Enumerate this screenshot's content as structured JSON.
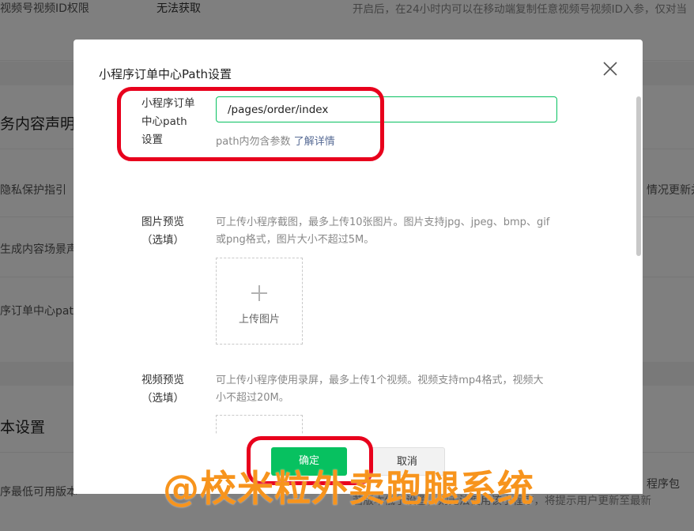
{
  "background": {
    "rows": [
      {
        "left": "视频号视频ID权限",
        "mid": "无法获取",
        "right": "开启后，在24小时内可以在移动端复制任意视频号视频ID入参，仅对当"
      },
      {
        "left": "务内容声明"
      },
      {
        "left": "隐私保护指引",
        "right": "情况更新并"
      },
      {
        "left": "生成内容场景声"
      },
      {
        "left": "序订单中心path"
      },
      {
        "left": "本设置"
      },
      {
        "left": "序最低可用版本",
        "right": "程序包"
      },
      {
        "right_partial": "若版本低于设置，则无法使用该小程序，将提示用户更新至最新"
      }
    ]
  },
  "dialog": {
    "title": "小程序订单中心Path设置",
    "path_field": {
      "label_lines": [
        "小程序订单",
        "中心path",
        "设置"
      ],
      "value": "/pages/order/index",
      "hint": "path内勿含参数",
      "hint_link": "了解详情"
    },
    "image_preview": {
      "label_lines": [
        "图片预览",
        "（选填）"
      ],
      "desc_lines": [
        "可上传小程序截图，最多上传10张图片。图片支持jpg、jpeg、bmp、gif",
        "或png格式，图片大小不超过5M。"
      ],
      "upload_label": "上传图片"
    },
    "video_preview": {
      "label_lines": [
        "视频预览",
        "（选填）"
      ],
      "desc_lines": [
        "可上传小程序使用录屏，最多上传1个视频。视频支持mp4格式，视频大",
        "小不超过20M。"
      ]
    },
    "buttons": {
      "confirm": "确定",
      "cancel": "取消"
    },
    "scroll_progress": 0.0
  },
  "watermark": "@校米粒外卖跑腿系统",
  "colors": {
    "accent_green": "#07c160",
    "link_blue": "#576b95",
    "annotation_red": "#e8001c",
    "watermark_orange": "#f7941d"
  },
  "icons": {
    "close": "close-icon",
    "upload": "plus-icon"
  }
}
